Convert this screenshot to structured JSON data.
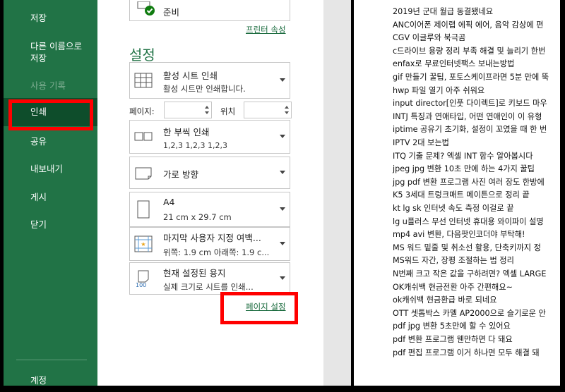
{
  "nav": {
    "save": "저장",
    "save_as_line1": "다른 이름으로",
    "save_as_line2": "저장",
    "history": "사용 기록",
    "print": "인쇄",
    "share": "공유",
    "export": "내보내기",
    "publish": "게시",
    "close": "닫기",
    "account": "계정"
  },
  "printer": {
    "status": "준비",
    "properties_link": "프린터 속성"
  },
  "settings": {
    "title": "설정",
    "scope": {
      "title": "활성 시트 인쇄",
      "subtitle": "활성 시트만 인쇄합니다."
    },
    "pages_label": "페이지:",
    "pages_from": "",
    "to_label": "위치",
    "pages_to": "",
    "sides": {
      "title": "한 부씩 인쇄",
      "subtitle": "1,2,3     1,2,3     1,2,3"
    },
    "orientation": {
      "title": "가로 방향"
    },
    "paper": {
      "title": "A4",
      "subtitle": "21 cm x 29.7 cm"
    },
    "margins": {
      "title": "마지막 사용자 지정 여백...",
      "subtitle": "위쪽: 1.9 cm 아래쪽: 1.9 c..."
    },
    "scaling": {
      "title": "현재 설정된 용지",
      "subtitle": "실제 크기로 시트를 인쇄...",
      "icon_text": "100"
    },
    "page_setup_link": "페이지 설정"
  },
  "preview_lines": [
    "2019년 군대 월급 동결됐네요",
    "ANC이어폰 제이랩 에픽 에어, 음악 감상에 편",
    "CGV 이글루와 북극곰",
    "c드라이브 용량 정리 부족 해결 및 늘리기 한번",
    "enfax로 무료인터넷팩스 보내는방법",
    "gif 만들기 꿀팁, 포토스케이프라면 5분 만에 뚝",
    "hwp 파일 열기 아주 쉬워요",
    "input director[인풋 다이렉트]로 키보드 마우",
    "INTJ 특징과 연애타입, 어떤 연애인이 이 유형",
    "iptime 공유기 초기화, 설정이 꼬였을 때 한 번",
    "IPTV 2대 보는법",
    "ITQ 기출 문제? 엑셀 INT 함수 알아봅시다",
    "jpeg jpg 변환 10초 만에 하는 4가지 꿀팁",
    "jpg pdf 변환 프로그램 사진 여러 장도 한방에",
    "K5 3세대 트렁크매트 메이튼으로 정리 끝",
    "kt lg sk 인터넷 속도 측정 이걸로 끝",
    "lg u플러스 무선 인터넷 휴대용 와이파이 설명",
    "mp4 avi 변환, 다음팟인코더야 부탁해!",
    "MS 워드 밑줄 및 취소선 활용, 단축키까지 정",
    "MS워드 자간, 장평 조절하는 법 정리",
    "N번째 크고 작은 값을 구하려면? 엑셀 LARGE",
    "OK캐쉬백 현금전환 아주 간편해요~",
    "ok캐쉬백 현금환급 바로 되네요",
    "OTT 셋톱박스 카멜 AP2000으로 슬기로운 안",
    "pdf jpg 변환 5초만에 할 수 있어요",
    "pdf 변환 프로그램 웬만하면 다 돼요",
    "pdf 편집 프로그램 이거 하나면 모두 해결 돼"
  ],
  "colors": {
    "nav_green": "#217346",
    "nav_selected": "#0e4d2b",
    "highlight_red": "#ff0000",
    "link_green": "#1a6b3e"
  }
}
